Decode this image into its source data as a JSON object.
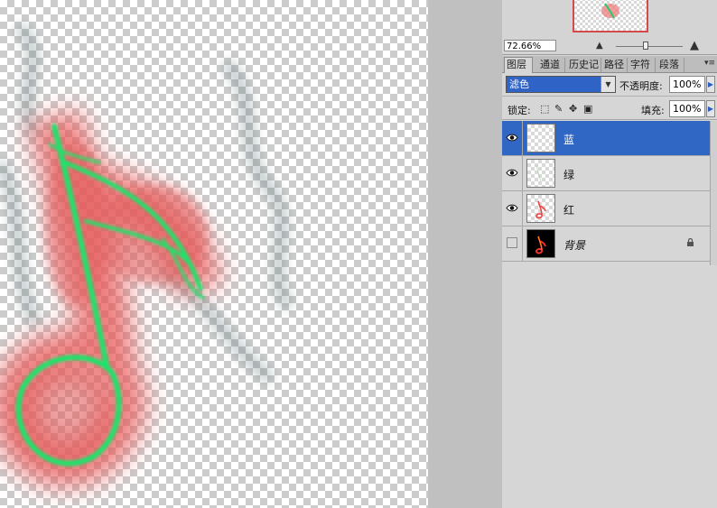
{
  "navigator": {
    "zoom_value": "72.66%",
    "zoom_out_icon": "small-mountain-icon",
    "zoom_in_icon": "large-mountain-icon",
    "zoom_slider_level": 0.45
  },
  "tabs": [
    {
      "label": "图层",
      "active": true
    },
    {
      "label": "通道",
      "active": false
    },
    {
      "label": "历史记",
      "active": false
    },
    {
      "label": "路径",
      "active": false
    },
    {
      "label": "字符",
      "active": false
    },
    {
      "label": "段落",
      "active": false
    }
  ],
  "panel_menu_icon": "panel-menu-icon",
  "blend": {
    "mode": "滤色",
    "opacity_label": "不透明度:",
    "opacity_value": "100%"
  },
  "lock": {
    "label": "锁定:",
    "fill_label": "填充:",
    "fill_value": "100%"
  },
  "layers": [
    {
      "name": "蓝",
      "visible": true,
      "selected": true,
      "locked": false
    },
    {
      "name": "绿",
      "visible": true,
      "selected": false,
      "locked": false
    },
    {
      "name": "红",
      "visible": true,
      "selected": false,
      "locked": false
    },
    {
      "name": "背景",
      "visible": false,
      "selected": false,
      "locked": true
    }
  ],
  "colors": {
    "accent": "#3066c4",
    "glow_red": "#e85555",
    "glow_green": "#22dd66"
  }
}
